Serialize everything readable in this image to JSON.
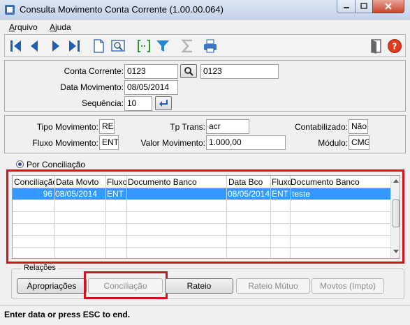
{
  "window": {
    "title": "Consulta Movimento Conta Corrente (1.00.00.064)"
  },
  "menu": [
    {
      "label": "Arquivo"
    },
    {
      "label": "Ajuda"
    }
  ],
  "toolbar": {
    "icons": [
      "first-record-icon",
      "previous-record-icon",
      "next-record-icon",
      "last-record-icon",
      "new-document-icon",
      "preview-icon",
      "select-range-icon",
      "filter-icon",
      "sum-icon",
      "print-icon",
      "exit-door-icon",
      "help-icon"
    ]
  },
  "header": {
    "conta_corrente_label": "Conta Corrente:",
    "conta_corrente_value": "0123",
    "conta_corrente_desc": "0123",
    "data_movimento_label": "Data Movimento:",
    "data_movimento_value": "08/05/2014",
    "sequencia_label": "Sequência:",
    "sequencia_value": "10"
  },
  "details": {
    "tipo_movimento_label": "Tipo Movimento:",
    "tipo_movimento_value": "RE",
    "tp_trans_label": "Tp Trans:",
    "tp_trans_value": "acr",
    "contabilizado_label": "Contabilizado:",
    "contabilizado_value": "Não",
    "fluxo_movimento_label": "Fluxo Movimento:",
    "fluxo_movimento_value": "ENT",
    "valor_movimento_label": "Valor Movimento:",
    "valor_movimento_value": "1.000,00",
    "modulo_label": "Módulo:",
    "modulo_value": "CMG"
  },
  "radio": {
    "label": "Por Conciliação"
  },
  "grid": {
    "columns": [
      "Conciliação",
      "Data Movto",
      "Fluxo",
      "Documento Banco",
      "Data Bco",
      "Fluxo",
      "Documento Banco"
    ],
    "rows": [
      {
        "conciliacao": "96",
        "data_movto": "08/05/2014",
        "fluxo": "ENT",
        "documento_banco": "",
        "data_bco": "08/05/2014",
        "fluxo_bco": "ENT",
        "documento_banco_2": "teste"
      }
    ]
  },
  "relacoes": {
    "title": "Relações",
    "buttons": {
      "apropriacoes": "Apropriações",
      "conciliacao": "Conciliação",
      "rateio": "Rateio",
      "rateio_mutuo": "Rateio Mútuo",
      "movtos": "Movtos (Impto)"
    }
  },
  "status": {
    "text": "Enter data or press ESC to end."
  },
  "colors": {
    "highlight": "#d4101c",
    "selection": "#3399ff",
    "toolbar_blue": "#1e5fb4"
  }
}
